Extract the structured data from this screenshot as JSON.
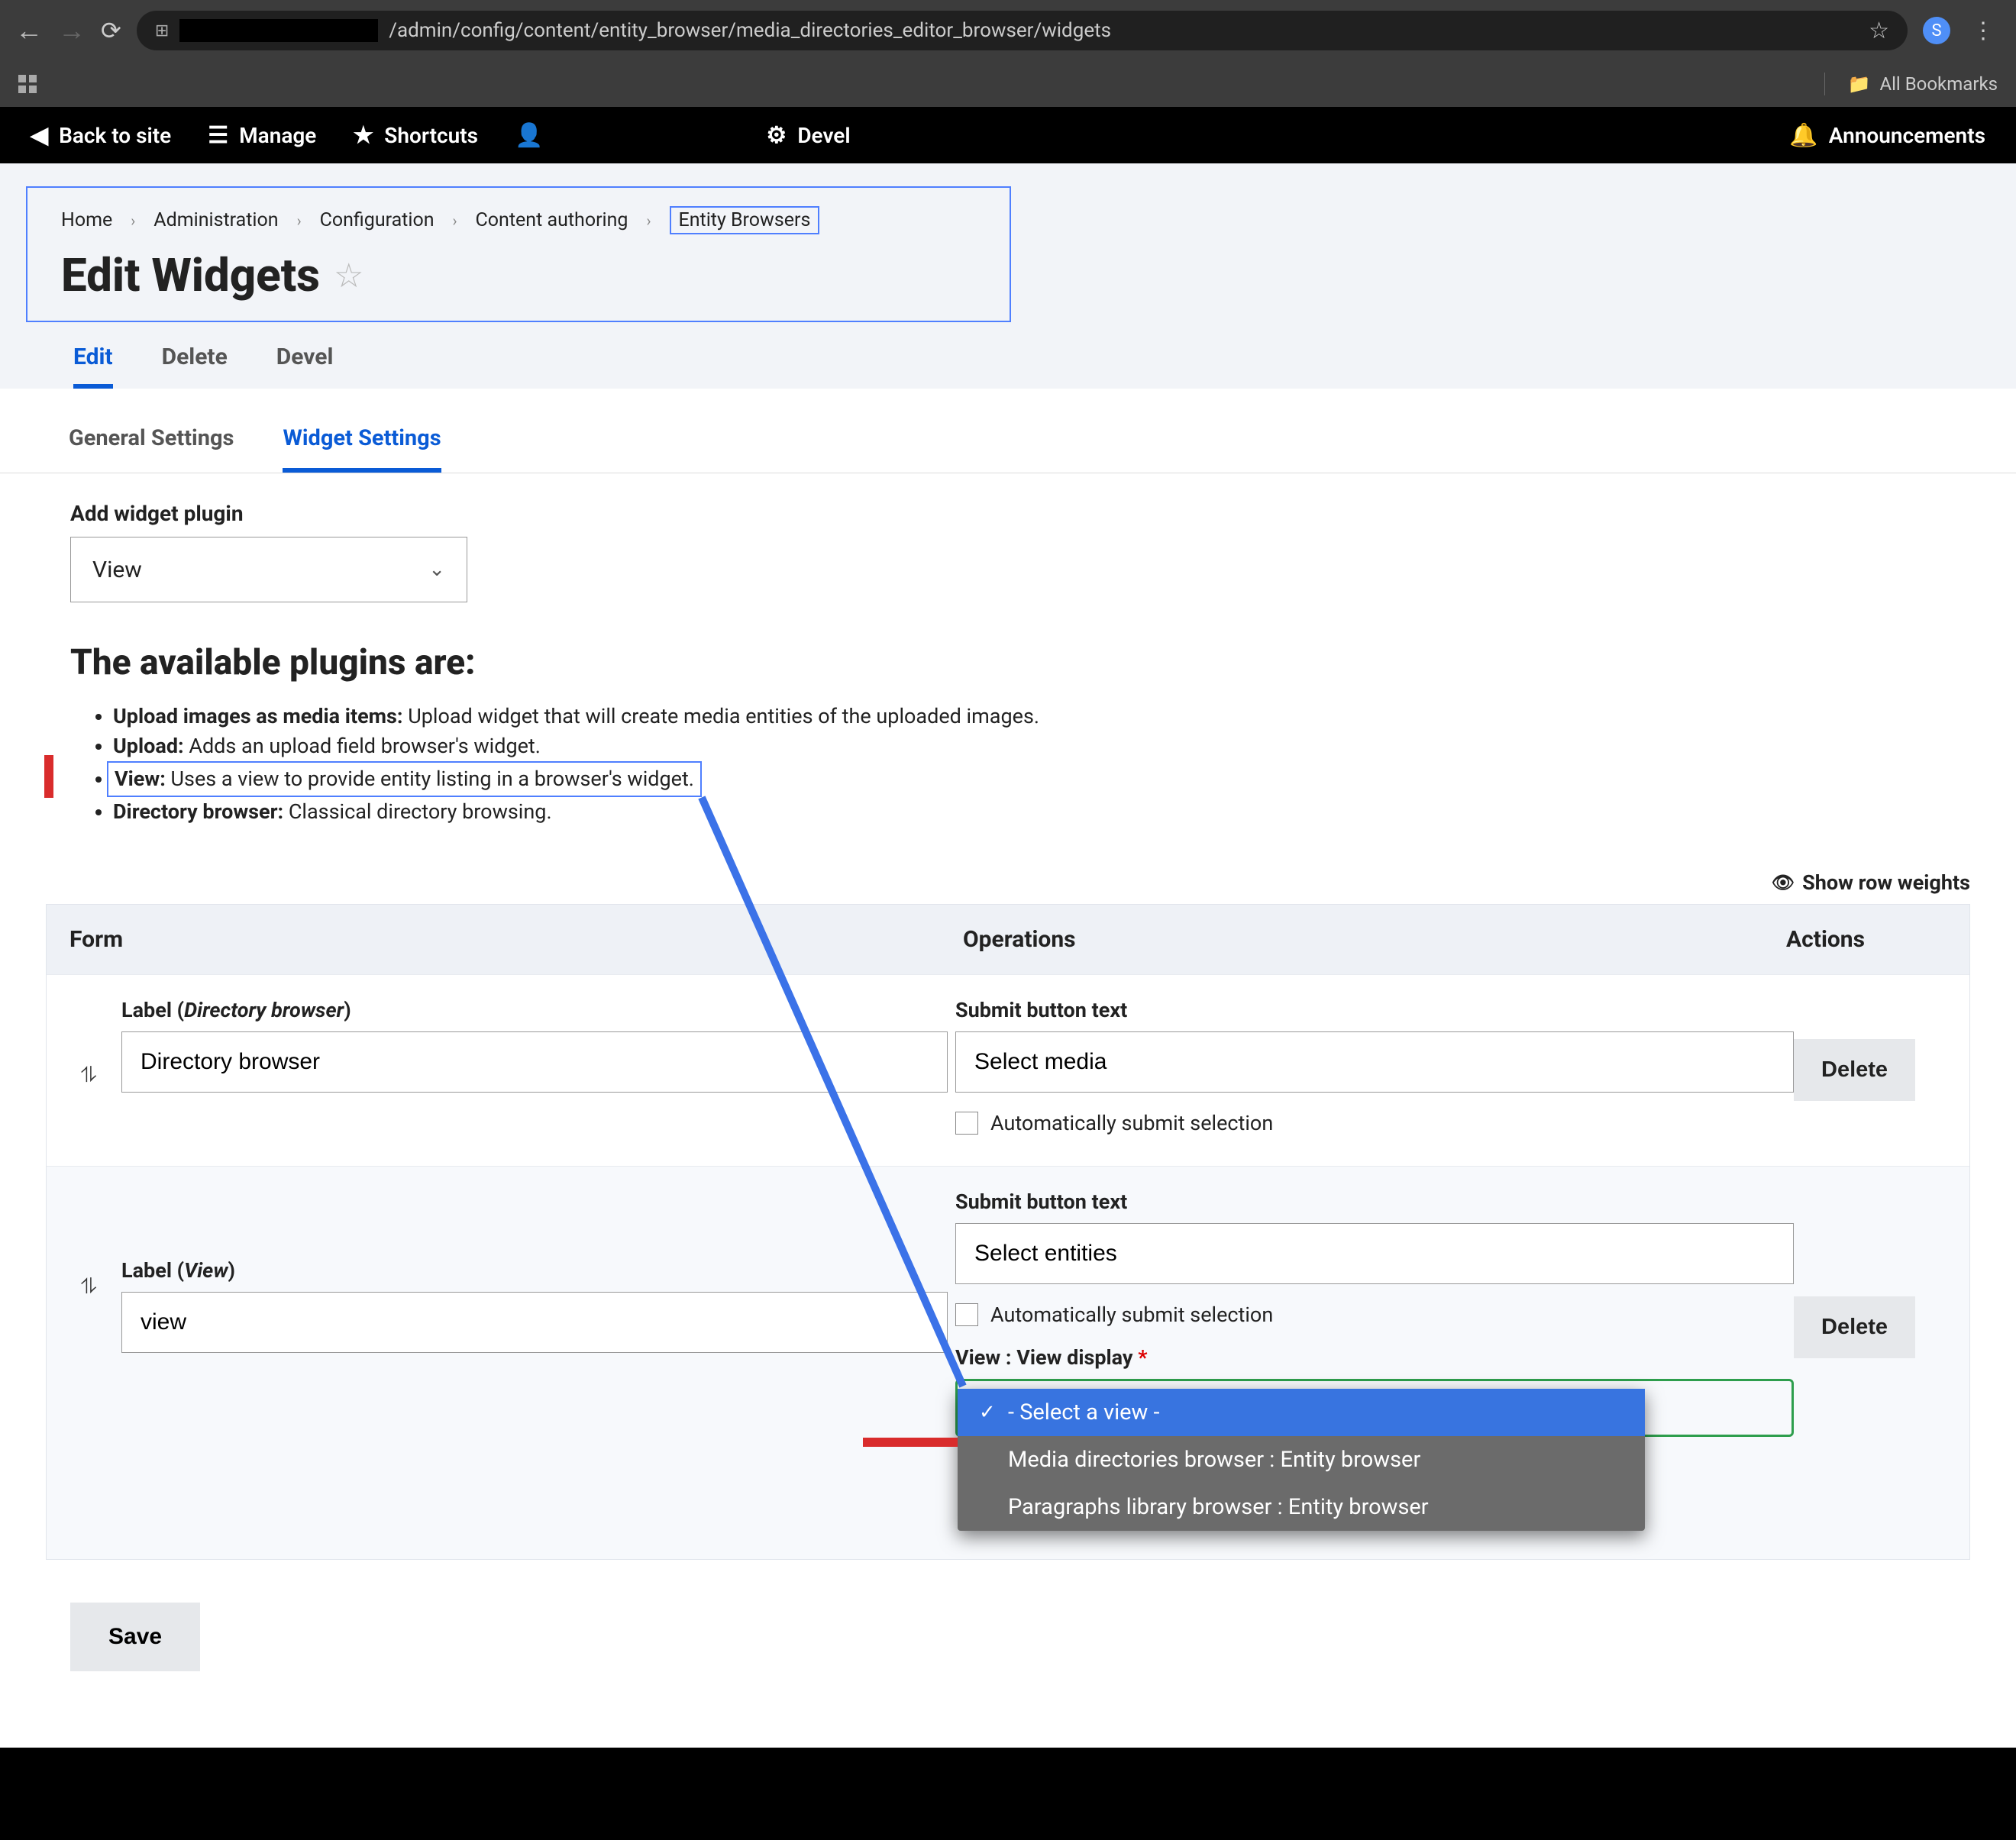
{
  "browser": {
    "url_path": "/admin/config/content/entity_browser/media_directories_editor_browser/widgets",
    "avatar_letter": "S",
    "all_bookmarks": "All Bookmarks"
  },
  "admin_toolbar": {
    "back_to_site": "Back to site",
    "manage": "Manage",
    "shortcuts": "Shortcuts",
    "devel": "Devel",
    "announcements": "Announcements"
  },
  "breadcrumb": {
    "items": [
      "Home",
      "Administration",
      "Configuration",
      "Content authoring",
      "Entity Browsers"
    ]
  },
  "page_title": "Edit Widgets",
  "primary_tabs": {
    "edit": "Edit",
    "delete": "Delete",
    "devel": "Devel"
  },
  "secondary_tabs": {
    "general": "General Settings",
    "widget": "Widget Settings"
  },
  "add_widget": {
    "label": "Add widget plugin",
    "value": "View"
  },
  "available_heading": "The available plugins are:",
  "plugins": {
    "p1_b": "Upload images as media items:",
    "p1_t": " Upload widget that will create media entities of the uploaded images.",
    "p2_b": "Upload:",
    "p2_t": " Adds an upload field browser's widget.",
    "p3_b": "View:",
    "p3_t": " Uses a view to provide entity listing in a browser's widget.",
    "p4_b": "Directory browser:",
    "p4_t": " Classical directory browsing."
  },
  "row_weights_label": "Show row weights",
  "table": {
    "headers": {
      "form": "Form",
      "ops": "Operations",
      "actions": "Actions"
    },
    "rows": [
      {
        "label_label": "Label (",
        "label_ital": "Directory browser",
        "label_close": ")",
        "label_value": "Directory browser",
        "submit_label": "Submit button text",
        "submit_value": "Select media",
        "auto_label": "Automatically submit selection",
        "delete": "Delete"
      },
      {
        "label_label": "Label (",
        "label_ital": "View",
        "label_close": ")",
        "label_value": "view",
        "submit_label": "Submit button text",
        "submit_value": "Select entities",
        "auto_label": "Automatically submit selection",
        "view_display_label": "View : View display",
        "delete": "Delete"
      }
    ]
  },
  "dropdown": {
    "opt0": "- Select a view -",
    "opt1": "Media directories browser : Entity browser",
    "opt2": "Paragraphs library browser : Entity browser"
  },
  "save": "Save"
}
